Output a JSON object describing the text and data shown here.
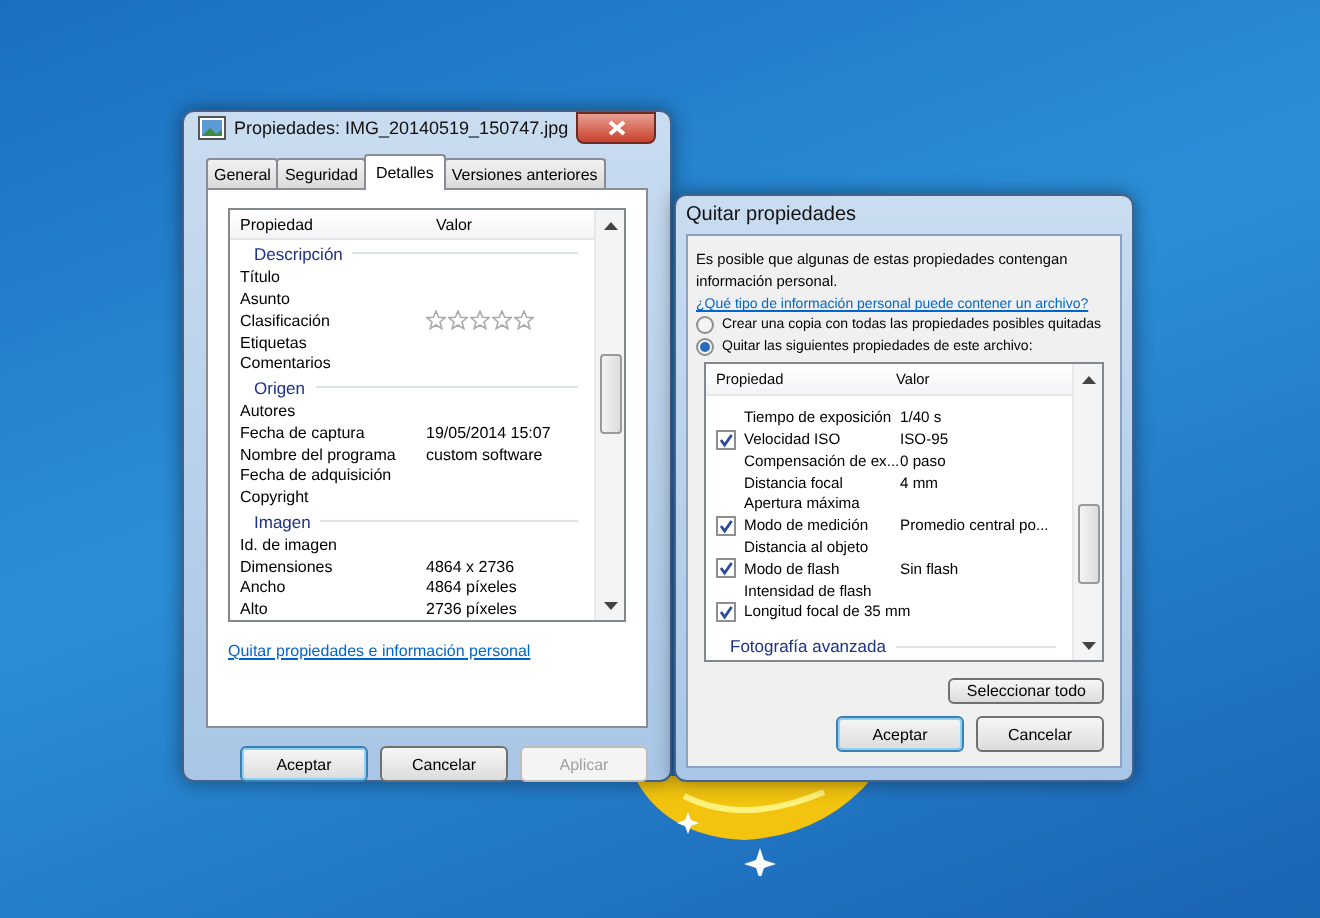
{
  "properties_dialog": {
    "title": "Propiedades: IMG_20140519_150747.jpg",
    "tabs": [
      {
        "label": "General",
        "selected": false
      },
      {
        "label": "Seguridad",
        "selected": false
      },
      {
        "label": "Detalles",
        "selected": true
      },
      {
        "label": "Versiones anteriores",
        "selected": false
      }
    ],
    "columns": [
      "Propiedad",
      "Valor"
    ],
    "items": [
      {
        "kind": "group",
        "label": "Descripción"
      },
      {
        "kind": "row",
        "name": "Título"
      },
      {
        "kind": "row",
        "name": "Asunto"
      },
      {
        "kind": "stars",
        "name": "Clasificación",
        "stars": 0
      },
      {
        "kind": "row",
        "name": "Etiquetas"
      },
      {
        "kind": "row",
        "name": "Comentarios"
      },
      {
        "kind": "group",
        "label": "Origen"
      },
      {
        "kind": "row",
        "name": "Autores"
      },
      {
        "kind": "row",
        "name": "Fecha de captura",
        "value": "19/05/2014 15:07"
      },
      {
        "kind": "row",
        "name": "Nombre del programa",
        "value": "custom software"
      },
      {
        "kind": "row",
        "name": "Fecha de adquisición"
      },
      {
        "kind": "row",
        "name": "Copyright"
      },
      {
        "kind": "group",
        "label": "Imagen"
      },
      {
        "kind": "row",
        "name": "Id. de imagen"
      },
      {
        "kind": "row",
        "name": "Dimensiones",
        "value": "4864 x 2736"
      },
      {
        "kind": "row",
        "name": "Ancho",
        "value": "4864 píxeles"
      },
      {
        "kind": "row",
        "name": "Alto",
        "value": "2736 píxeles"
      }
    ],
    "link": "Quitar propiedades e información personal",
    "buttons": [
      {
        "label": "Aceptar",
        "default": true,
        "disabled": false
      },
      {
        "label": "Cancelar",
        "default": false,
        "disabled": false
      },
      {
        "label": "Aplicar",
        "default": false,
        "disabled": true
      }
    ]
  },
  "remove_dialog": {
    "title": "Quitar propiedades",
    "intro": "Es posible que algunas de estas propiedades contengan información personal.",
    "link": "¿Qué tipo de información personal puede contener un archivo?",
    "options": [
      {
        "label": "Crear una copia con todas las propiedades posibles quitadas",
        "selected": false
      },
      {
        "label": "Quitar las siguientes propiedades de este archivo:",
        "selected": true
      }
    ],
    "columns": [
      "Propiedad",
      "Valor"
    ],
    "items": [
      {
        "kind": "row",
        "name": "Tiempo de exposición",
        "value": "1/40 s",
        "checked": false
      },
      {
        "kind": "row",
        "name": "Velocidad ISO",
        "value": "ISO-95",
        "checked": true
      },
      {
        "kind": "row",
        "name": "Compensación de ex...",
        "value": "0 paso",
        "checked": false
      },
      {
        "kind": "row",
        "name": "Distancia focal",
        "value": "4 mm",
        "checked": false
      },
      {
        "kind": "row",
        "name": "Apertura máxima",
        "checked": false
      },
      {
        "kind": "row",
        "name": "Modo de medición",
        "value": "Promedio central po...",
        "checked": true
      },
      {
        "kind": "row",
        "name": "Distancia al objeto",
        "checked": false
      },
      {
        "kind": "row",
        "name": "Modo de flash",
        "value": "Sin flash",
        "checked": true
      },
      {
        "kind": "row",
        "name": "Intensidad de flash",
        "checked": false
      },
      {
        "kind": "row",
        "name": "Longitud focal de 35 mm",
        "checked": true
      },
      {
        "kind": "group",
        "label": "Fotografía avanzada"
      }
    ],
    "select_all_button": "Seleccionar todo",
    "buttons": [
      {
        "label": "Aceptar",
        "default": true,
        "disabled": false
      },
      {
        "label": "Cancelar",
        "default": false,
        "disabled": false
      }
    ]
  }
}
